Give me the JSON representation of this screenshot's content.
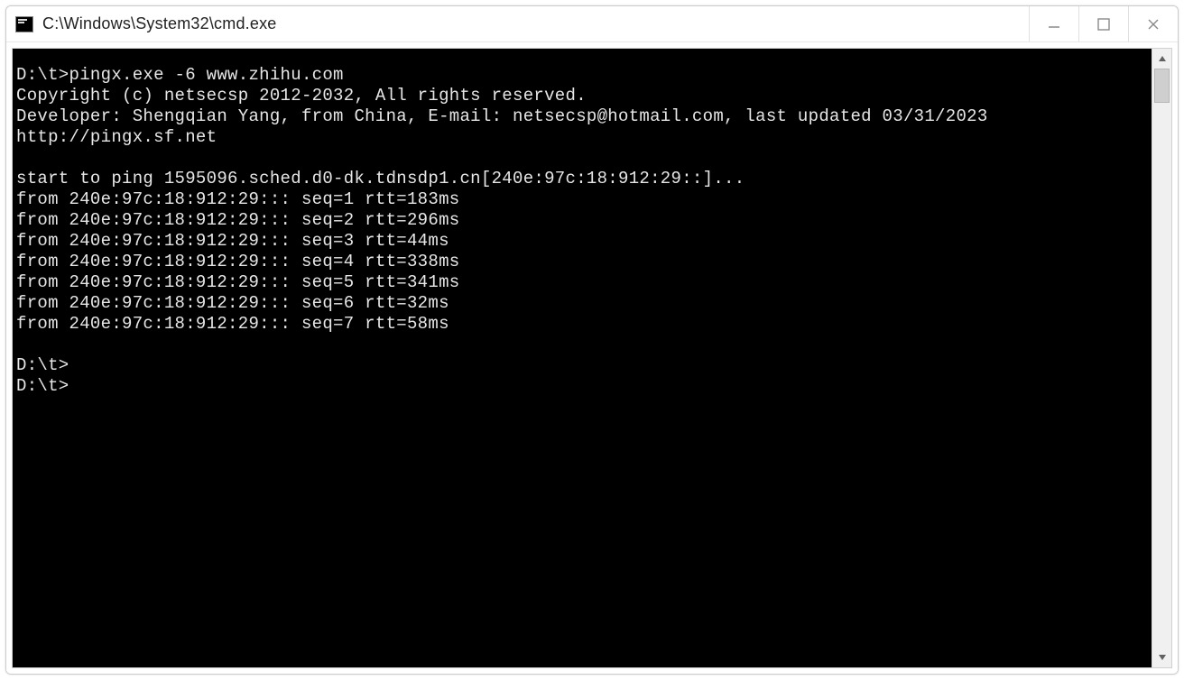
{
  "window": {
    "title": "C:\\Windows\\System32\\cmd.exe"
  },
  "terminal": {
    "prompt1": "D:\\t>",
    "command": "pingx.exe -6 www.zhihu.com",
    "copyright": "Copyright (c) netsecsp 2012-2032, All rights reserved.",
    "developer": "Developer: Shengqian Yang, from China, E-mail: netsecsp@hotmail.com, last updated 03/31/2023",
    "url": "http://pingx.sf.net",
    "startline": "start to ping 1595096.sched.d0-dk.tdnsdp1.cn[240e:97c:18:912:29::]...",
    "addr": "240e:97c:18:912:29::",
    "replies": [
      {
        "seq": 1,
        "rtt": 183
      },
      {
        "seq": 2,
        "rtt": 296
      },
      {
        "seq": 3,
        "rtt": 44
      },
      {
        "seq": 4,
        "rtt": 338
      },
      {
        "seq": 5,
        "rtt": 341
      },
      {
        "seq": 6,
        "rtt": 32
      },
      {
        "seq": 7,
        "rtt": 58
      }
    ],
    "prompt_empty1": "D:\\t>",
    "prompt_empty2": "D:\\t>"
  }
}
